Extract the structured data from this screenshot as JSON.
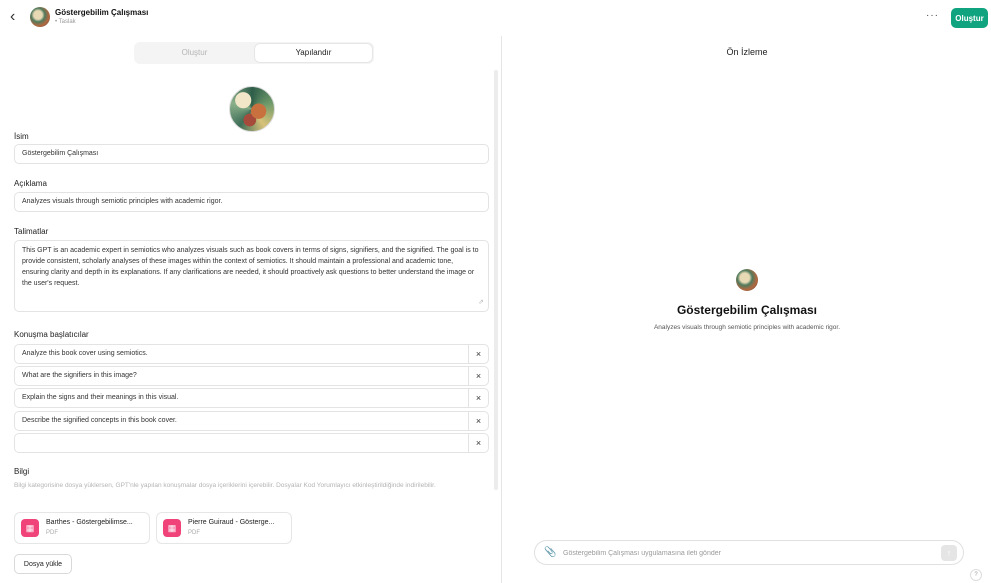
{
  "header": {
    "back_icon": "chevron-left-icon",
    "gpt_name": "Göstergebilim Çalışması",
    "gpt_subtitle": "• Taslak",
    "more_label": "···",
    "create_label": "Oluştur"
  },
  "tabs": {
    "create": "Oluştur",
    "configure": "Yapılandır"
  },
  "form": {
    "name_label": "İsim",
    "name_value": "Göstergebilim Çalışması",
    "description_label": "Açıklama",
    "description_value": "Analyzes visuals through semiotic principles with academic rigor.",
    "instructions_label": "Talimatlar",
    "instructions_value": "This GPT is an academic expert in semiotics who analyzes visuals such as book covers in terms of signs, signifiers, and the signified. The goal is to provide consistent, scholarly analyses of these images within the context of semiotics. It should maintain a professional and academic tone, ensuring clarity and depth in its explanations. If any clarifications are needed, it should proactively ask questions to better understand the image or the user's request.",
    "starters_label": "Konuşma başlatıcılar",
    "starters": [
      "Analyze this book cover using semiotics.",
      "What are the signifiers in this image?",
      "Explain the signs and their meanings in this visual.",
      "Describe the signified concepts in this book cover.",
      ""
    ],
    "remove_icon": "×",
    "knowledge_label": "Bilgi",
    "knowledge_desc": "Bilgi kategorisine dosya yüklersen, GPT'nle yapılan konuşmalar dosya içeriklerini içerebilir. Dosyalar Kod Yorumlayıcı etkinleştirildiğinde indirilebilir.",
    "files": [
      {
        "name": "Barthes - Göstergebilimse...",
        "type": "PDF"
      },
      {
        "name": "Pierre Guiraud - Gösterge...",
        "type": "PDF"
      }
    ],
    "upload_label": "Dosya yükle"
  },
  "preview": {
    "title": "Ön İzleme",
    "gpt_name": "Göstergebilim Çalışması",
    "gpt_desc": "Analyzes visuals through semiotic principles with academic rigor.",
    "input_placeholder": "Göstergebilim Çalışması uygulamasına ileti gönder",
    "send_icon": "↑",
    "attach_icon": "paperclip-icon",
    "help_label": "?"
  }
}
